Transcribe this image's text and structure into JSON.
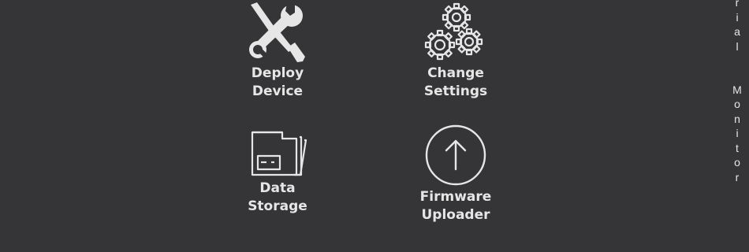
{
  "tiles": {
    "deploy": {
      "line1": "Deploy",
      "line2": "Device",
      "icon": "tools-icon"
    },
    "settings": {
      "line1": "Change",
      "line2": "Settings",
      "icon": "gears-icon"
    },
    "storage": {
      "line1": "Data",
      "line2": "Storage",
      "icon": "folder-icon"
    },
    "firmware": {
      "line1": "Firmware",
      "line2": "Uploader",
      "icon": "upload-arrow-icon"
    }
  },
  "side_tab": {
    "label": "rial Monitor",
    "chars": [
      "r",
      "i",
      "a",
      "l",
      "",
      "",
      "M",
      "o",
      "n",
      "i",
      "t",
      "o",
      "r"
    ]
  },
  "colors": {
    "background": "#353538",
    "foreground": "#e6e6e6"
  }
}
